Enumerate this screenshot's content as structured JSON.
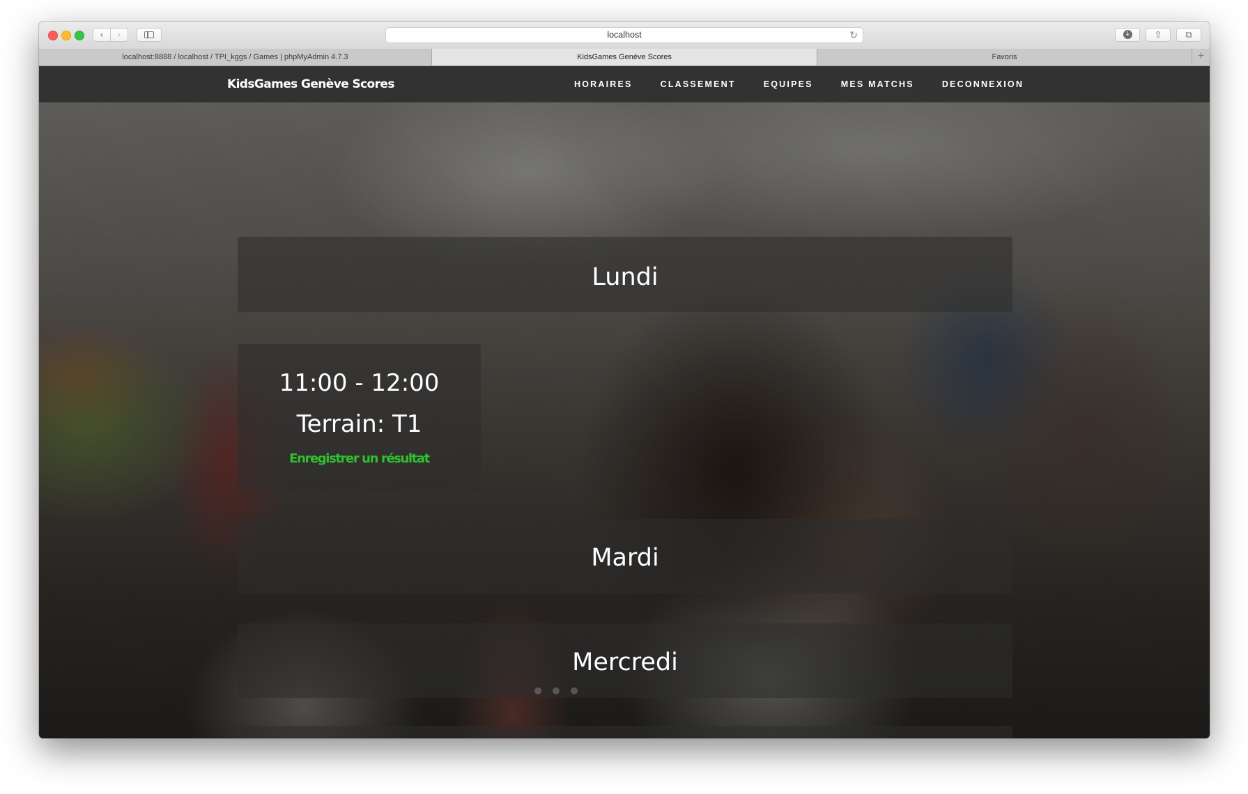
{
  "browser": {
    "address": "localhost",
    "tabs": [
      {
        "label": "localhost:8888 / localhost / TPI_kggs / Games | phpMyAdmin 4.7.3"
      },
      {
        "label": "KidsGames Genève Scores"
      },
      {
        "label": "Favoris"
      }
    ],
    "new_tab": "+"
  },
  "site": {
    "brand": "KidsGames Genève Scores",
    "nav": [
      {
        "label": "HORAIRES"
      },
      {
        "label": "CLASSEMENT"
      },
      {
        "label": "EQUIPES"
      },
      {
        "label": "MES MATCHS"
      },
      {
        "label": "DECONNEXION"
      }
    ]
  },
  "schedule": {
    "days": [
      {
        "label": "Lundi"
      },
      {
        "label": "Mardi"
      },
      {
        "label": "Mercredi"
      }
    ],
    "match": {
      "time": "11:00 - 12:00",
      "field": "Terrain: T1",
      "action": "Enregistrer un résultat"
    }
  },
  "colors": {
    "action_green": "#2fbf2f",
    "navbar_bg": "#282828"
  },
  "icons": [
    "back-icon",
    "forward-icon",
    "sidebar-icon",
    "reload-icon",
    "download-icon",
    "share-icon",
    "tabs-icon"
  ]
}
